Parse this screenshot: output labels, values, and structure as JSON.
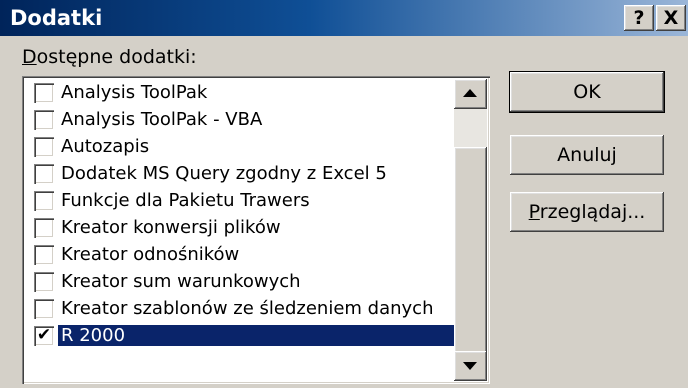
{
  "window": {
    "title": "Dodatki",
    "help_glyph": "?",
    "close_glyph": "X"
  },
  "available": {
    "label_accel": "D",
    "label_rest": "ostępne dodatki:"
  },
  "addins": [
    {
      "label": "Analysis ToolPak",
      "checked": false,
      "selected": false
    },
    {
      "label": "Analysis ToolPak - VBA",
      "checked": false,
      "selected": false
    },
    {
      "label": "Autozapis",
      "checked": false,
      "selected": false
    },
    {
      "label": "Dodatek MS Query zgodny z Excel 5",
      "checked": false,
      "selected": false
    },
    {
      "label": "Funkcje dla Pakietu Trawers",
      "checked": false,
      "selected": false
    },
    {
      "label": "Kreator konwersji plików",
      "checked": false,
      "selected": false
    },
    {
      "label": "Kreator odnośników",
      "checked": false,
      "selected": false
    },
    {
      "label": "Kreator sum warunkowych",
      "checked": false,
      "selected": false
    },
    {
      "label": "Kreator szablonów ze śledzeniem danych",
      "checked": false,
      "selected": false
    },
    {
      "label": "R 2000",
      "checked": true,
      "selected": true
    }
  ],
  "buttons": {
    "ok": "OK",
    "cancel": "Anuluj",
    "browse_accel": "P",
    "browse_rest": "rzeglądaj..."
  },
  "colors": {
    "dialog_face": "#d4d0c8",
    "title_start": "#00245a",
    "title_end": "#9bb6d8",
    "selection": "#0a246a"
  },
  "icons": {
    "help": "question-mark-icon",
    "close": "close-x-icon",
    "scroll_up": "triangle-up-icon",
    "scroll_down": "triangle-down-icon",
    "check": "checkmark-icon"
  }
}
